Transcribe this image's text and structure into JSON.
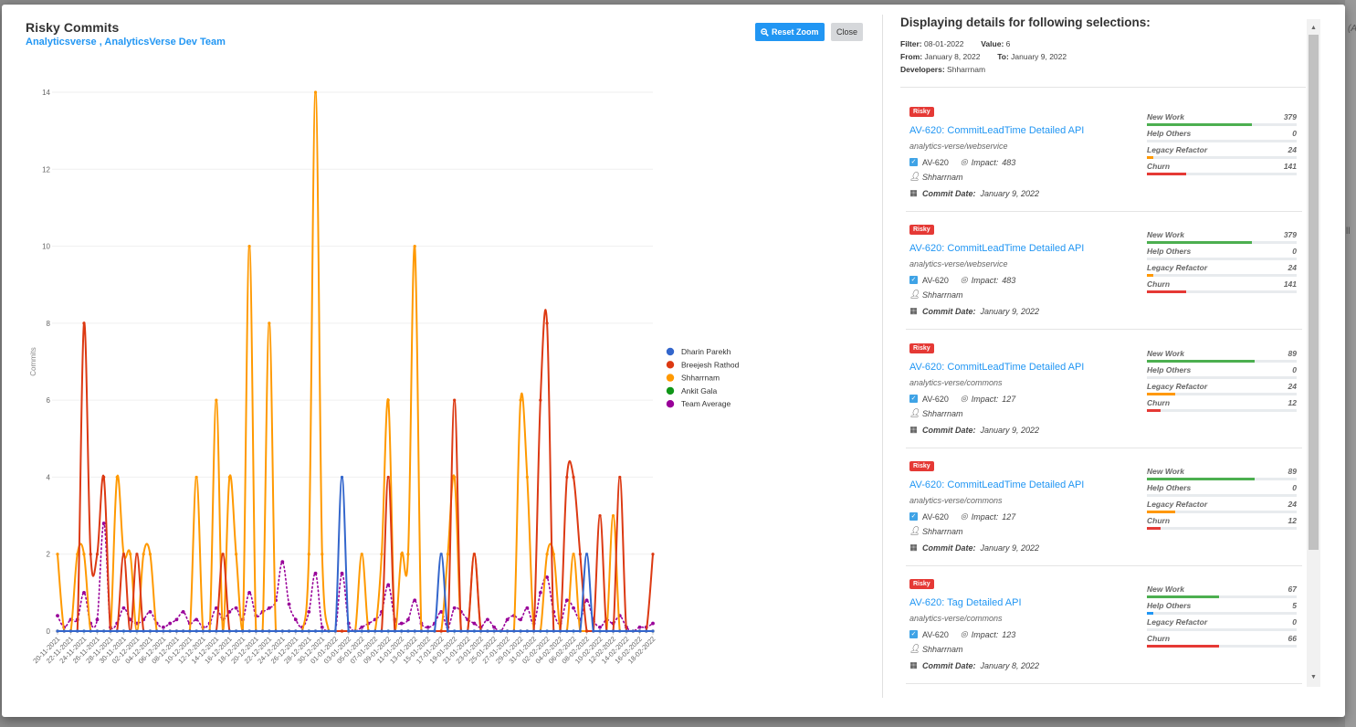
{
  "modal": {
    "title": "Risky Commits",
    "subtitle": "Analyticsverse , AnalyticsVerse Dev Team",
    "reset_zoom_label": "Reset Zoom",
    "close_label": "Close"
  },
  "backdrop": {
    "text_1": "(Al",
    "text_2": "ll"
  },
  "colors": {
    "accent": "#2196f3",
    "risky": "#e53935",
    "new_work": "#4caf50",
    "help_others": "#2196f3",
    "legacy_refactor": "#ff9800",
    "churn": "#e53935"
  },
  "chart_data": {
    "type": "line",
    "title": "",
    "xlabel": "",
    "ylabel": "Commits",
    "ylim": [
      0,
      14
    ],
    "yticks": [
      0,
      2,
      4,
      6,
      8,
      10,
      12,
      14
    ],
    "grid": true,
    "legend_position": "right",
    "x_tick_labels": [
      "20-11-2021",
      "22-11-2021",
      "24-11-2021",
      "26-11-2021",
      "28-11-2021",
      "30-11-2021",
      "02-12-2021",
      "04-12-2021",
      "06-12-2021",
      "08-12-2021",
      "10-12-2021",
      "12-12-2021",
      "14-12-2021",
      "16-12-2021",
      "18-12-2021",
      "20-12-2021",
      "22-12-2021",
      "24-12-2021",
      "26-12-2021",
      "28-12-2021",
      "30-12-2021",
      "01-01-2022",
      "03-01-2022",
      "05-01-2022",
      "07-01-2022",
      "09-01-2022",
      "11-01-2022",
      "13-01-2022",
      "15-01-2022",
      "17-01-2022",
      "19-01-2022",
      "21-01-2022",
      "23-01-2022",
      "25-01-2022",
      "27-01-2022",
      "29-01-2022",
      "31-01-2022",
      "02-02-2022",
      "04-02-2022",
      "06-02-2022",
      "08-02-2022",
      "10-02-2022",
      "12-02-2022",
      "14-02-2022",
      "16-02-2022",
      "18-02-2022"
    ],
    "x_start": "20-11-2021",
    "num_days": 91,
    "series": [
      {
        "name": "Dharin Parekh",
        "color": "#3366cc",
        "dash": false,
        "values": [
          0,
          0,
          0,
          0,
          0,
          0,
          0,
          0,
          0,
          0,
          0,
          0,
          0,
          0,
          0,
          0,
          0,
          0,
          0,
          0,
          0,
          0,
          0,
          0,
          0,
          0,
          0,
          0,
          0,
          0,
          0,
          0,
          0,
          0,
          0,
          0,
          0,
          0,
          0,
          0,
          0,
          0,
          0,
          4,
          0,
          0,
          0,
          0,
          0,
          0,
          0,
          0,
          0,
          0,
          0,
          0,
          0,
          0,
          2,
          0,
          0,
          0,
          0,
          0,
          0,
          0,
          0,
          0,
          0,
          0,
          0,
          0,
          0,
          0,
          0,
          0,
          0,
          0,
          0,
          0,
          2,
          0,
          0,
          0,
          0,
          0,
          0,
          0,
          0,
          0,
          0
        ]
      },
      {
        "name": "Breejesh Rathod",
        "color": "#dc3912",
        "dash": false,
        "values": [
          0,
          0,
          0,
          0,
          8,
          2,
          2,
          4,
          0,
          0,
          2,
          0,
          2,
          0,
          0,
          0,
          0,
          0,
          0,
          0,
          0,
          0,
          0,
          0,
          0,
          2,
          0,
          0,
          0,
          0,
          0,
          0,
          0,
          0,
          0,
          0,
          0,
          0,
          0,
          0,
          0,
          0,
          0,
          0,
          0,
          0,
          0,
          0,
          0,
          0,
          4,
          0,
          0,
          0,
          0,
          0,
          0,
          0,
          0,
          0,
          6,
          0,
          0,
          2,
          0,
          0,
          0,
          0,
          0,
          0,
          0,
          0,
          0,
          6,
          8,
          0,
          0,
          4,
          4,
          2,
          0,
          0,
          3,
          0,
          0,
          4,
          0,
          0,
          0,
          0,
          2
        ]
      },
      {
        "name": "Shharrnam",
        "color": "#ff9900",
        "dash": false,
        "values": [
          2,
          0,
          0,
          2,
          2,
          0,
          0,
          0,
          0,
          4,
          2,
          2,
          0,
          2,
          2,
          0,
          0,
          0,
          0,
          0,
          0,
          4,
          0,
          0,
          6,
          0,
          4,
          2,
          0,
          10,
          0,
          0,
          8,
          0,
          0,
          0,
          0,
          0,
          2,
          14,
          2,
          0,
          0,
          0,
          0,
          0,
          2,
          0,
          0,
          2,
          6,
          0,
          2,
          2,
          10,
          0,
          0,
          0,
          0,
          2,
          4,
          0,
          0,
          2,
          0,
          0,
          0,
          0,
          0,
          0,
          6,
          4,
          0,
          0,
          2,
          2,
          0,
          0,
          2,
          0,
          0,
          0,
          0,
          0,
          3,
          0,
          0,
          0,
          0,
          0,
          0
        ]
      },
      {
        "name": "Ankit Gala",
        "color": "#109618",
        "dash": false,
        "values": [
          0,
          0,
          0,
          0,
          0,
          0,
          0,
          0,
          0,
          0,
          0,
          0,
          0,
          0,
          0,
          0,
          0,
          0,
          0,
          0,
          0,
          0,
          0,
          0,
          0,
          0,
          0,
          0,
          0,
          0,
          0,
          0,
          0,
          0,
          0,
          0,
          0,
          0,
          0,
          0,
          0,
          0,
          0,
          0,
          0,
          0,
          0,
          0,
          0,
          0,
          0,
          0,
          0,
          0,
          0,
          0,
          0,
          0,
          0,
          0,
          0,
          0,
          0,
          0,
          0,
          0,
          0,
          0,
          0,
          0,
          0,
          0,
          0,
          0,
          0,
          0,
          0,
          0,
          0,
          0,
          0,
          0,
          0,
          0,
          0,
          0,
          0,
          0,
          0,
          0,
          0
        ]
      },
      {
        "name": "Team Average",
        "color": "#990099",
        "dash": true,
        "values": [
          0.4,
          0.1,
          0.3,
          0.3,
          1.0,
          0.2,
          0.3,
          2.8,
          0.1,
          0.2,
          0.6,
          0.3,
          0.2,
          0.3,
          0.5,
          0.2,
          0.1,
          0.2,
          0.3,
          0.5,
          0.2,
          0.3,
          0.1,
          0.2,
          0.6,
          0.3,
          0.5,
          0.6,
          0.3,
          1.0,
          0.4,
          0.5,
          0.6,
          0.8,
          1.8,
          0.7,
          0.3,
          0.1,
          0.5,
          1.5,
          0.1,
          0.0,
          0.0,
          1.5,
          0.2,
          0.0,
          0.1,
          0.2,
          0.3,
          0.5,
          1.2,
          0.3,
          0.2,
          0.3,
          0.8,
          0.2,
          0.1,
          0.2,
          0.5,
          0.1,
          0.6,
          0.5,
          0.3,
          0.2,
          0.1,
          0.3,
          0.1,
          0.0,
          0.3,
          0.4,
          0.3,
          0.6,
          0.2,
          1.0,
          1.4,
          0.5,
          0.2,
          0.8,
          0.6,
          0.3,
          0.8,
          0.3,
          0.1,
          0.3,
          0.2,
          0.4,
          0.1,
          0.0,
          0.1,
          0.1,
          0.2
        ]
      }
    ]
  },
  "details": {
    "heading": "Displaying details for following selections:",
    "filter_label": "Filter:",
    "filter_value": "08-01-2022",
    "value_label": "Value:",
    "value_value": "6",
    "from_label": "From:",
    "from_value": "January 8, 2022",
    "to_label": "To:",
    "to_value": "January 9, 2022",
    "developers_label": "Developers:",
    "developers_value": "Shharrnam",
    "metric_labels": [
      "New Work",
      "Help Others",
      "Legacy Refactor",
      "Churn"
    ],
    "commit_date_label": "Commit Date:",
    "impact_label": "Impact:",
    "commits": [
      {
        "badge": "Risky",
        "title": "AV-620: CommitLeadTime Detailed API",
        "repo": "analytics-verse/webservice",
        "ticket": "AV-620",
        "impact": "483",
        "author": "Shharrnam",
        "commit_date": "January 9, 2022",
        "metrics": [
          {
            "value": "379",
            "fill": 0.7
          },
          {
            "value": "0",
            "fill": 0.0
          },
          {
            "value": "24",
            "fill": 0.04
          },
          {
            "value": "141",
            "fill": 0.26
          }
        ]
      },
      {
        "badge": "Risky",
        "title": "AV-620: CommitLeadTime Detailed API",
        "repo": "analytics-verse/webservice",
        "ticket": "AV-620",
        "impact": "483",
        "author": "Shharrnam",
        "commit_date": "January 9, 2022",
        "metrics": [
          {
            "value": "379",
            "fill": 0.7
          },
          {
            "value": "0",
            "fill": 0.0
          },
          {
            "value": "24",
            "fill": 0.04
          },
          {
            "value": "141",
            "fill": 0.26
          }
        ]
      },
      {
        "badge": "Risky",
        "title": "AV-620: CommitLeadTime Detailed API",
        "repo": "analytics-verse/commons",
        "ticket": "AV-620",
        "impact": "127",
        "author": "Shharrnam",
        "commit_date": "January 9, 2022",
        "metrics": [
          {
            "value": "89",
            "fill": 0.72
          },
          {
            "value": "0",
            "fill": 0.0
          },
          {
            "value": "24",
            "fill": 0.19
          },
          {
            "value": "12",
            "fill": 0.09
          }
        ]
      },
      {
        "badge": "Risky",
        "title": "AV-620: CommitLeadTime Detailed API",
        "repo": "analytics-verse/commons",
        "ticket": "AV-620",
        "impact": "127",
        "author": "Shharrnam",
        "commit_date": "January 9, 2022",
        "metrics": [
          {
            "value": "89",
            "fill": 0.72
          },
          {
            "value": "0",
            "fill": 0.0
          },
          {
            "value": "24",
            "fill": 0.19
          },
          {
            "value": "12",
            "fill": 0.09
          }
        ]
      },
      {
        "badge": "Risky",
        "title": "AV-620: Tag Detailed API",
        "repo": "analytics-verse/commons",
        "ticket": "AV-620",
        "impact": "123",
        "author": "Shharrnam",
        "commit_date": "January 8, 2022",
        "metrics": [
          {
            "value": "67",
            "fill": 0.48
          },
          {
            "value": "5",
            "fill": 0.04
          },
          {
            "value": "0",
            "fill": 0.0
          },
          {
            "value": "66",
            "fill": 0.48
          }
        ]
      }
    ]
  }
}
